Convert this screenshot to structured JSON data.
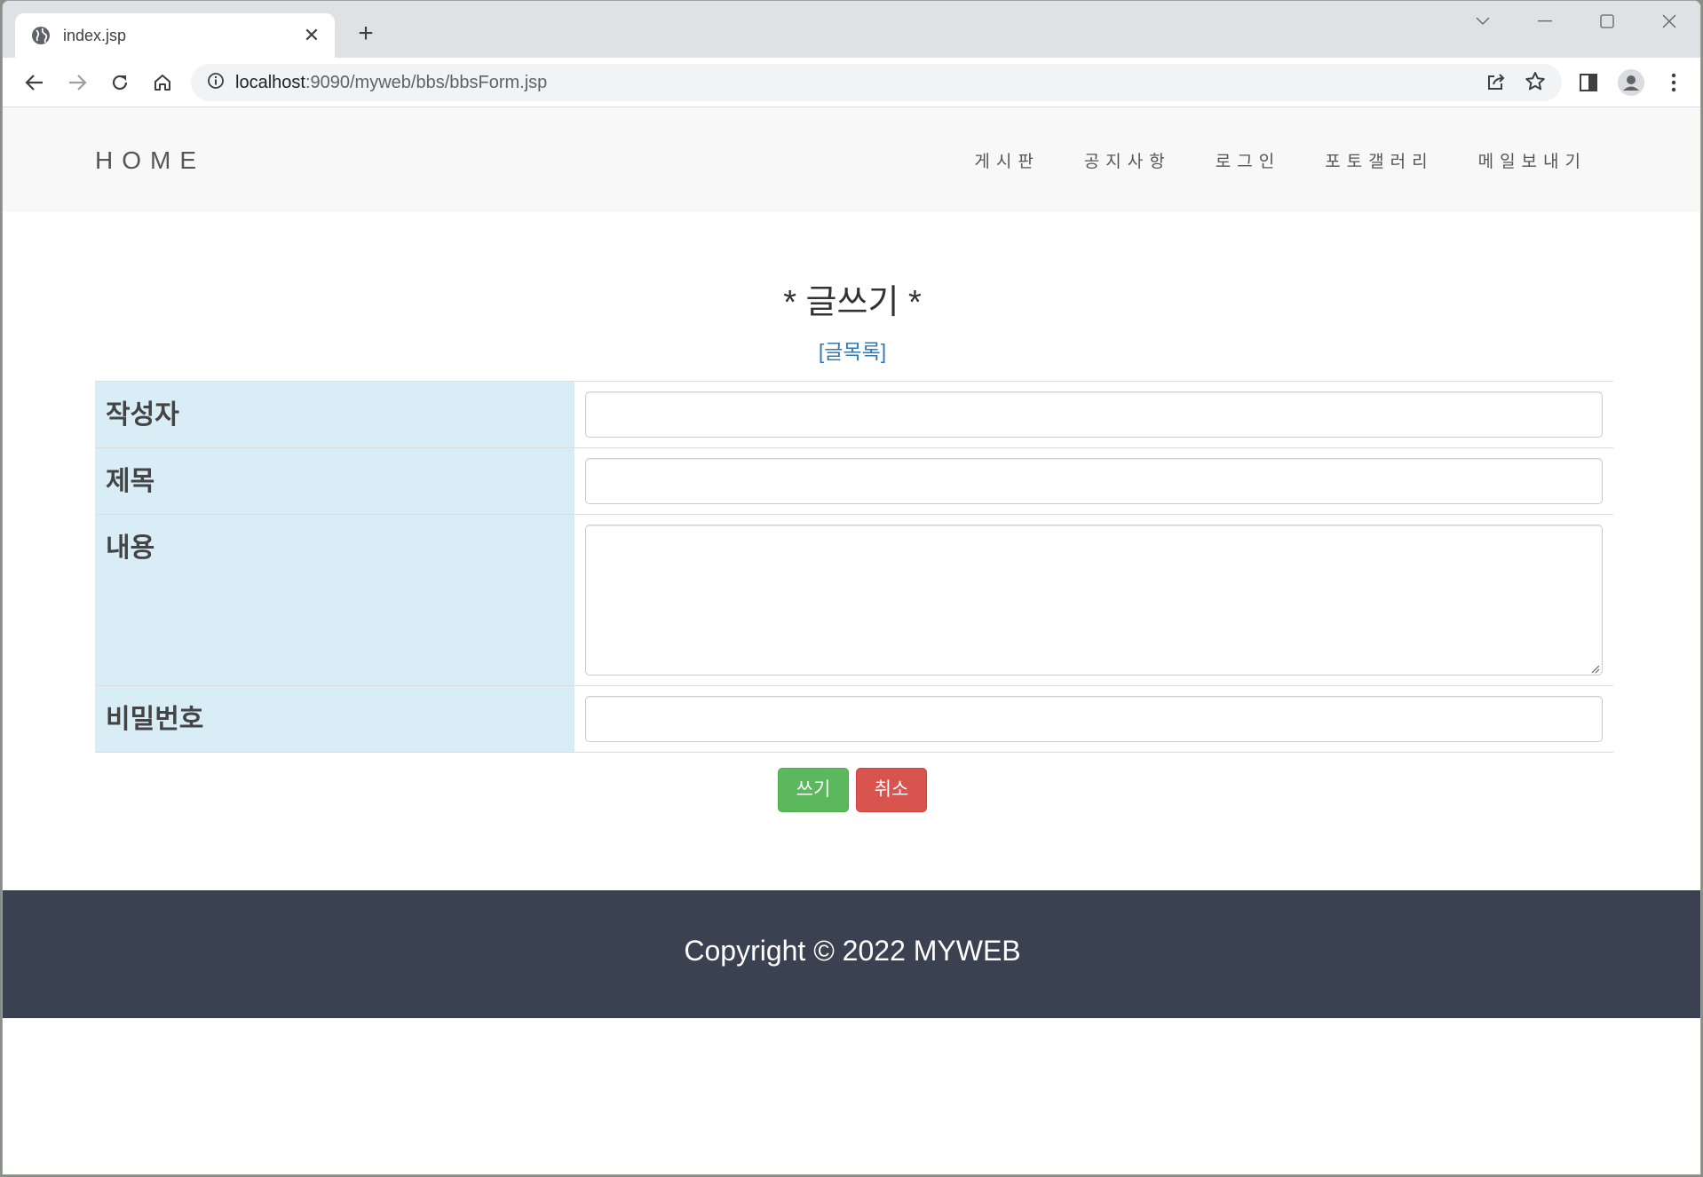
{
  "browser": {
    "tab_title": "index.jsp",
    "url_host": "localhost",
    "url_path": ":9090/myweb/bbs/bbsForm.jsp"
  },
  "icons": {
    "globe": "globe-icon",
    "close": "close-icon",
    "new_tab": "plus-icon",
    "back": "arrow-left-icon",
    "forward": "arrow-right-icon",
    "reload": "reload-icon",
    "home": "home-icon",
    "info": "info-icon",
    "share": "share-icon",
    "bookmark": "star-icon",
    "sidepanel": "side-panel-icon",
    "profile": "profile-icon",
    "menu": "kebab-menu-icon"
  },
  "site": {
    "brand": "HOME",
    "menu": [
      "게시판",
      "공지사항",
      "로그인",
      "포토갤러리",
      "메일보내기"
    ]
  },
  "form": {
    "title": "* 글쓰기 *",
    "list_link": "[글목록]",
    "rows": [
      {
        "label": "작성자",
        "value": ""
      },
      {
        "label": "제목",
        "value": ""
      },
      {
        "label": "내용",
        "value": ""
      },
      {
        "label": "비밀번호",
        "value": ""
      }
    ],
    "submit_label": "쓰기",
    "cancel_label": "취소"
  },
  "colors": {
    "label_bg": "#d9edf7",
    "submit": "#5cb85c",
    "cancel": "#d9534f",
    "footer": "#3a4150",
    "link": "#337ab7"
  },
  "footer": {
    "copyright": "Copyright © 2022 MYWEB"
  }
}
